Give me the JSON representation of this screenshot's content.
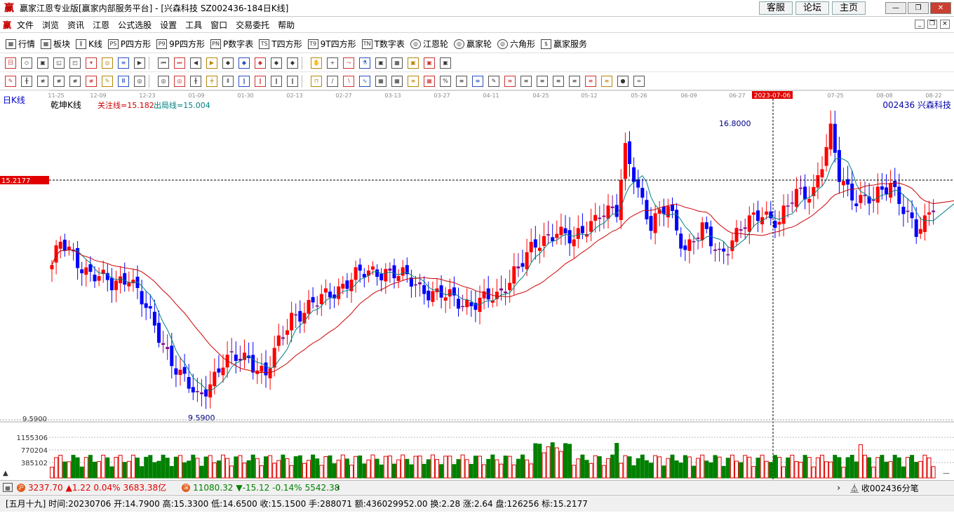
{
  "window": {
    "title": "赢家江恩专业版[赢家内部服务平台] - [兴森科技  SZ002436-184日K线]",
    "links": [
      "客服",
      "论坛",
      "主页"
    ],
    "winbtns": [
      "—",
      "❐",
      "✕"
    ]
  },
  "menu": {
    "items": [
      "文件",
      "浏览",
      "资讯",
      "江恩",
      "公式选股",
      "设置",
      "工具",
      "窗口",
      "交易委托",
      "帮助"
    ],
    "mdi": [
      "_",
      "❐",
      "×"
    ]
  },
  "toolbar1": {
    "items": [
      {
        "icon": "grid-icon",
        "glyph": "▦",
        "label": "行情"
      },
      {
        "icon": "blocks-icon",
        "glyph": "▦",
        "label": "板块"
      },
      {
        "icon": "candle-icon",
        "glyph": "⫼",
        "label": "K线"
      },
      {
        "icon": "ps-icon",
        "glyph": "PS",
        "label": "P四方形"
      },
      {
        "icon": "p9-icon",
        "glyph": "P9",
        "label": "9P四方形"
      },
      {
        "icon": "pn-icon",
        "glyph": "PN",
        "label": "P数字表"
      },
      {
        "icon": "ts-icon",
        "glyph": "TS",
        "label": "T四方形"
      },
      {
        "icon": "t9-icon",
        "glyph": "T9",
        "label": "9T四方形"
      },
      {
        "icon": "tn-icon",
        "glyph": "TN",
        "label": "T数字表"
      },
      {
        "icon": "target-icon",
        "glyph": "◎",
        "label": "江恩轮"
      },
      {
        "icon": "wheel-icon",
        "glyph": "◎",
        "label": "赢家轮"
      },
      {
        "icon": "hexagon-icon",
        "glyph": "◎",
        "label": "六角形"
      },
      {
        "icon": "dollar-icon",
        "glyph": "$",
        "label": "赢家服务"
      }
    ]
  },
  "chart_header": {
    "period": "日K线",
    "name": "乾坤K线",
    "focus_line": "关注线=15.182",
    "exit_line": "出局线=15.004",
    "stock": "002436  兴森科技",
    "high_marker": "16.8000",
    "low_marker": "9.5900",
    "price_axis_low": "9.5900",
    "cursor_price": "15.2177",
    "cursor_date": "2023-07-06",
    "vol_labels": [
      "1155306",
      "770204",
      "385102"
    ],
    "dates": [
      "11-25",
      "12-09",
      "12-23",
      "01-09",
      "01-30",
      "02-13",
      "02-27",
      "03-13",
      "03-27",
      "04-11",
      "04-25",
      "05-12",
      "05-26",
      "06-09",
      "06-27",
      "2023-07-06",
      "07-25",
      "08-08",
      "08-22"
    ]
  },
  "chart_data": {
    "type": "candlestick",
    "y_range": [
      9.59,
      16.8
    ],
    "high": 16.8,
    "low": 9.59,
    "cursor": {
      "date": "2023-07-06",
      "price": 15.2177
    },
    "focus_line": 15.182,
    "exit_line": 15.004,
    "colors": {
      "up": "#ff0000",
      "down": "#0000ff",
      "neutral": "#7b0b8a",
      "ma_short": "#008080",
      "ma_long": "#cc0000",
      "volume": "#008000"
    }
  },
  "status": {
    "sh_index": "3237.70",
    "sh_change": "▲1.22 0.04%",
    "sh_amount": "3683.38亿",
    "sz_index": "11080.32",
    "sz_change": "▼-15.12 -0.14%",
    "sz_amount": "5542.38",
    "collect": "收002436分笔"
  },
  "quote": {
    "text": "[五月十九] 时间:20230706 开:14.7900 高:15.3300 低:14.6500 收:15.1500 手:288071 额:436029952.00 换:2.28 涨:2.64 盘:126256 标:15.2177"
  }
}
